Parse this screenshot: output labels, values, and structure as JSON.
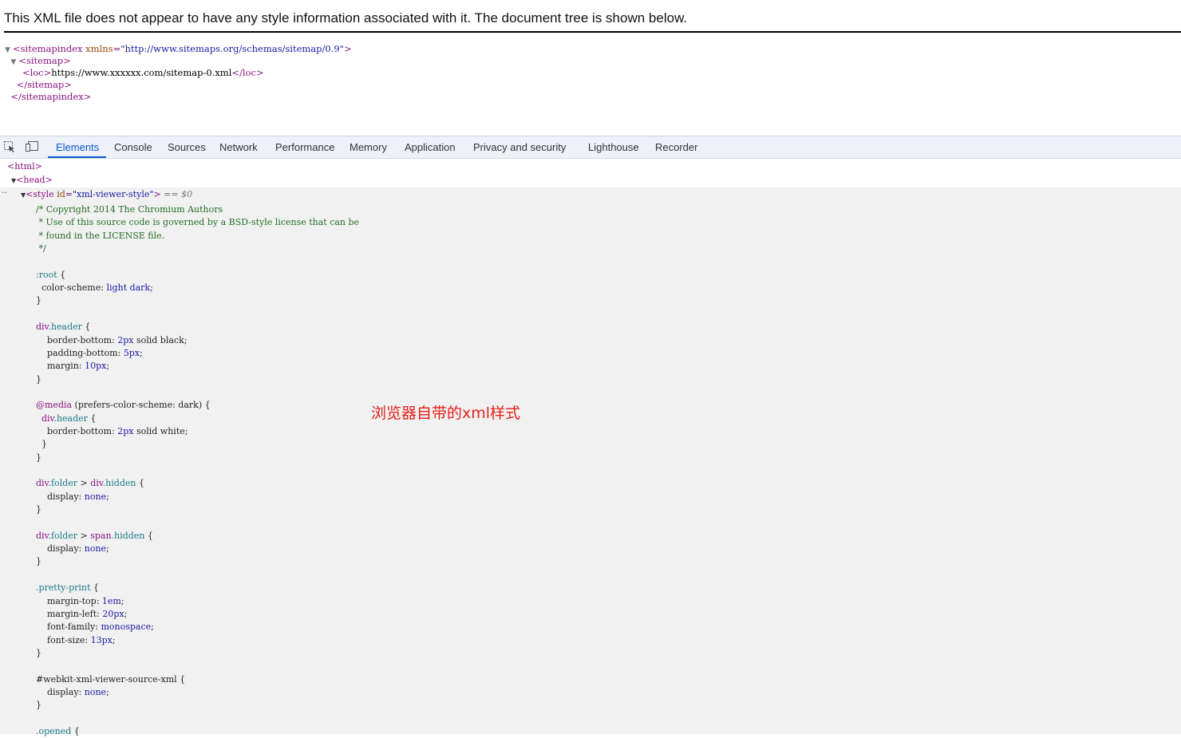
{
  "xml_page": {
    "header": "This XML file does not appear to have any style information associated with it. The document tree is shown below.",
    "tree": {
      "sitemapindex_open_tag": "<sitemapindex",
      "xmlns_attr": "xmlns",
      "xmlns_value": "\"http://www.sitemaps.org/schemas/sitemap/0.9\"",
      "open_close": ">",
      "sitemap_open": "<sitemap>",
      "loc_open": "<loc>",
      "loc_text": "https://www.xxxxxx.com/sitemap-0.xml",
      "loc_close": "</loc>",
      "sitemap_close": "</sitemap>",
      "sitemapindex_close": "</sitemapindex>"
    }
  },
  "devtools": {
    "tabs": [
      "Elements",
      "Console",
      "Sources",
      "Network",
      "Performance",
      "Memory",
      "Application",
      "Privacy and security",
      "Lighthouse",
      "Recorder"
    ],
    "active_tab": "Elements",
    "dom": {
      "html_tag": "<html>",
      "head_tag": "<head>",
      "style_open": "<style",
      "style_id_attr": "id",
      "style_id_value": "\"xml-viewer-style\"",
      "style_suffix": ">",
      "selected_marker": "== $0",
      "ellipsis": "··"
    },
    "css_lines": [
      "/* Copyright 2014 The Chromium Authors",
      " * Use of this source code is governed by a BSD-style license that can be",
      " * found in the LICENSE file.",
      " */",
      "",
      ":root {",
      "  color-scheme: light dark;",
      "}",
      "",
      "div.header {",
      "    border-bottom: 2px solid black;",
      "    padding-bottom: 5px;",
      "    margin: 10px;",
      "}",
      "",
      "@media (prefers-color-scheme: dark) {",
      "  div.header {",
      "    border-bottom: 2px solid white;",
      "  }",
      "}",
      "",
      "div.folder > div.hidden {",
      "    display:none;",
      "}",
      "",
      "div.folder > span.hidden {",
      "    display:none;",
      "}",
      "",
      ".pretty-print {",
      "    margin-top: 1em;",
      "    margin-left: 20px;",
      "    font-family: monospace;",
      "    font-size: 13px;",
      "}",
      "",
      "#webkit-xml-viewer-source-xml {",
      "    display: none;",
      "}",
      "",
      ".opened {"
    ],
    "annotation": "浏览器自带的xml样式"
  },
  "colors": {
    "accent": "#0b57d0",
    "annotation": "#e2201b",
    "tag": "#881280",
    "comment": "#236e25"
  }
}
